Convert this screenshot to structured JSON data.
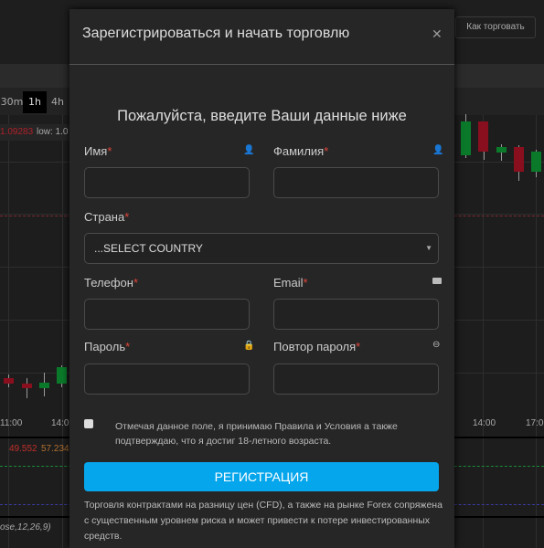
{
  "background": {
    "how_to_trade": "Как торговать",
    "timeframes": [
      "30m",
      "1h",
      "4h"
    ],
    "active_timeframe": "1h",
    "price_high": "1.09283",
    "low_label": "low: 1.0",
    "time_labels": [
      "11:00",
      "14:00",
      "14:00",
      "17:00"
    ],
    "indicator_values": [
      "49.552",
      "57.234"
    ],
    "macd_label": "ose,12,26,9)",
    "colors": {
      "up": "#0a7a2a",
      "down": "#8a0f1e"
    }
  },
  "modal": {
    "title": "Зарегистрироваться и начать торговлю",
    "close_icon": "close-icon",
    "subtitle": "Пожалуйста, введите Ваши данные ниже",
    "fields": {
      "first_name": {
        "label": "Имя",
        "value": "",
        "icon": "user-icon"
      },
      "last_name": {
        "label": "Фамилия",
        "value": "",
        "icon": "user-icon"
      },
      "country": {
        "label": "Страна",
        "selected": "...SELECT COUNTRY"
      },
      "phone": {
        "label": "Телефон",
        "value": ""
      },
      "email": {
        "label": "Email",
        "value": "",
        "icon": "envelope-icon"
      },
      "password": {
        "label": "Пароль",
        "value": "",
        "icon": "lock-icon"
      },
      "password_repeat": {
        "label": "Повтор пароля",
        "value": "",
        "icon": "repeat-icon"
      }
    },
    "required_mark": "*",
    "terms": "Отмечая данное поле, я принимаю Правила и Условия а также подтверждаю, что я достиг 18-летного возраста.",
    "register_button": "РЕГИСТРАЦИЯ",
    "disclaimer": "Торговля контрактами на разницу цен (CFD), а также на рынке Forex сопряжена с существенным уровнем риска и может привести к потере инвестированных средств.",
    "accent": "#06a6ec"
  }
}
